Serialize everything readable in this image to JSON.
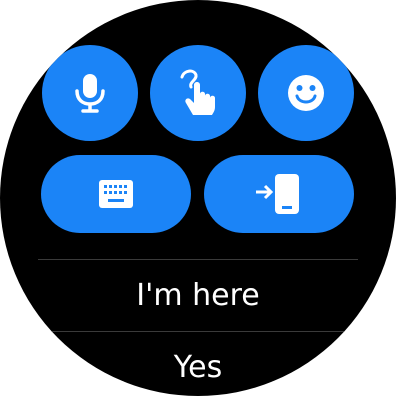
{
  "colors": {
    "background": "#000000",
    "button": "#1b84f7",
    "icon": "#ffffff",
    "divider": "#3a3a3a",
    "text": "#ffffff"
  },
  "input_buttons": [
    {
      "id": "voice",
      "icon": "microphone-icon"
    },
    {
      "id": "handwriting",
      "icon": "handwriting-icon"
    },
    {
      "id": "emoji",
      "icon": "emoji-icon"
    },
    {
      "id": "keyboard",
      "icon": "keyboard-icon"
    },
    {
      "id": "phone",
      "icon": "send-to-phone-icon"
    }
  ],
  "quick_replies": [
    {
      "label": "I'm here"
    },
    {
      "label": "Yes"
    }
  ]
}
